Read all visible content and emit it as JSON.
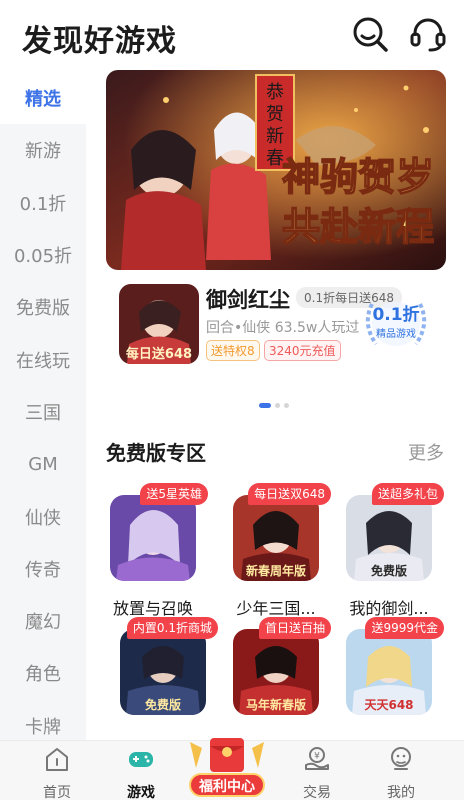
{
  "header": {
    "title": "发现好游戏",
    "icons": [
      "search-icon",
      "customer-service-icon"
    ]
  },
  "sidebar": {
    "items": [
      {
        "label": "精选",
        "active": true
      },
      {
        "label": "新游",
        "active": false
      },
      {
        "label": "0.1折",
        "active": false
      },
      {
        "label": "0.05折",
        "active": false
      },
      {
        "label": "免费版",
        "active": false
      },
      {
        "label": "在线玩",
        "active": false
      },
      {
        "label": "三国",
        "active": false
      },
      {
        "label": "GM",
        "active": false
      },
      {
        "label": "仙侠",
        "active": false
      },
      {
        "label": "传奇",
        "active": false
      },
      {
        "label": "魔幻",
        "active": false
      },
      {
        "label": "角色",
        "active": false
      },
      {
        "label": "卡牌",
        "active": false
      }
    ]
  },
  "banner": {
    "headline": "神驹贺岁",
    "subline": "共赴新程",
    "scroll_text": "恭贺新春",
    "slide_count": 3,
    "active_slide": 1
  },
  "featured_game": {
    "name": "御剑红尘",
    "tagline": "0.1折每日送648",
    "meta": "回合•仙侠  63.5w人玩过",
    "tags": [
      "送特权8",
      "3240元充值"
    ],
    "badge_big": "0.1折",
    "badge_small": "精品游戏",
    "thumb_text": "每日送648"
  },
  "section": {
    "title": "免费版专区",
    "more": "更多",
    "tiles": [
      {
        "name": "放置与召唤",
        "ribbon": "送5星英雄",
        "art_text": ""
      },
      {
        "name": "少年三国...",
        "ribbon": "每日送双648",
        "art_text": "新春周年版"
      },
      {
        "name": "我的御剑...",
        "ribbon": "送超多礼包",
        "art_text": "免费版"
      },
      {
        "name": "",
        "ribbon": "内置0.1折商城",
        "art_text": "免费版"
      },
      {
        "name": "",
        "ribbon": "首日送百抽",
        "art_text": "马年新春版"
      },
      {
        "name": "",
        "ribbon": "送9999代金",
        "art_text": "天天648"
      }
    ]
  },
  "bottom_nav": {
    "items": [
      {
        "label": "首页",
        "icon": "home-icon",
        "active": false
      },
      {
        "label": "游戏",
        "icon": "gamepad-icon",
        "active": true
      },
      {
        "label": "交易",
        "icon": "trade-icon",
        "active": false
      },
      {
        "label": "我的",
        "icon": "profile-icon",
        "active": false
      }
    ],
    "center": {
      "label": "福利中心",
      "icon": "red-envelope-icon"
    }
  },
  "colors": {
    "accent": "#3e73e8",
    "ribbon": "#f2424a",
    "sidebar_bg": "#f5f6f8"
  }
}
